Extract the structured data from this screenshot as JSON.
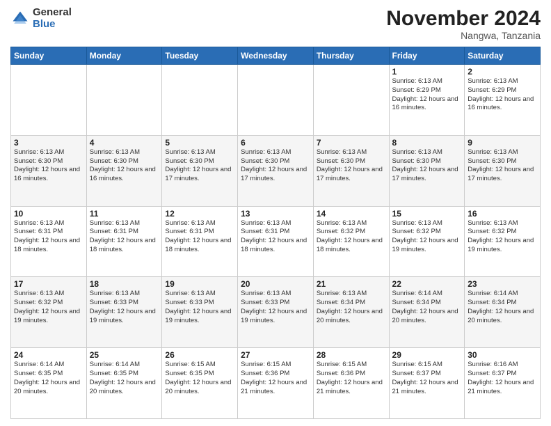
{
  "logo": {
    "general": "General",
    "blue": "Blue"
  },
  "header": {
    "month": "November 2024",
    "location": "Nangwa, Tanzania"
  },
  "days_of_week": [
    "Sunday",
    "Monday",
    "Tuesday",
    "Wednesday",
    "Thursday",
    "Friday",
    "Saturday"
  ],
  "weeks": [
    [
      {
        "day": "",
        "info": ""
      },
      {
        "day": "",
        "info": ""
      },
      {
        "day": "",
        "info": ""
      },
      {
        "day": "",
        "info": ""
      },
      {
        "day": "",
        "info": ""
      },
      {
        "day": "1",
        "info": "Sunrise: 6:13 AM\nSunset: 6:29 PM\nDaylight: 12 hours and 16 minutes."
      },
      {
        "day": "2",
        "info": "Sunrise: 6:13 AM\nSunset: 6:29 PM\nDaylight: 12 hours and 16 minutes."
      }
    ],
    [
      {
        "day": "3",
        "info": "Sunrise: 6:13 AM\nSunset: 6:30 PM\nDaylight: 12 hours and 16 minutes."
      },
      {
        "day": "4",
        "info": "Sunrise: 6:13 AM\nSunset: 6:30 PM\nDaylight: 12 hours and 16 minutes."
      },
      {
        "day": "5",
        "info": "Sunrise: 6:13 AM\nSunset: 6:30 PM\nDaylight: 12 hours and 17 minutes."
      },
      {
        "day": "6",
        "info": "Sunrise: 6:13 AM\nSunset: 6:30 PM\nDaylight: 12 hours and 17 minutes."
      },
      {
        "day": "7",
        "info": "Sunrise: 6:13 AM\nSunset: 6:30 PM\nDaylight: 12 hours and 17 minutes."
      },
      {
        "day": "8",
        "info": "Sunrise: 6:13 AM\nSunset: 6:30 PM\nDaylight: 12 hours and 17 minutes."
      },
      {
        "day": "9",
        "info": "Sunrise: 6:13 AM\nSunset: 6:30 PM\nDaylight: 12 hours and 17 minutes."
      }
    ],
    [
      {
        "day": "10",
        "info": "Sunrise: 6:13 AM\nSunset: 6:31 PM\nDaylight: 12 hours and 18 minutes."
      },
      {
        "day": "11",
        "info": "Sunrise: 6:13 AM\nSunset: 6:31 PM\nDaylight: 12 hours and 18 minutes."
      },
      {
        "day": "12",
        "info": "Sunrise: 6:13 AM\nSunset: 6:31 PM\nDaylight: 12 hours and 18 minutes."
      },
      {
        "day": "13",
        "info": "Sunrise: 6:13 AM\nSunset: 6:31 PM\nDaylight: 12 hours and 18 minutes."
      },
      {
        "day": "14",
        "info": "Sunrise: 6:13 AM\nSunset: 6:32 PM\nDaylight: 12 hours and 18 minutes."
      },
      {
        "day": "15",
        "info": "Sunrise: 6:13 AM\nSunset: 6:32 PM\nDaylight: 12 hours and 19 minutes."
      },
      {
        "day": "16",
        "info": "Sunrise: 6:13 AM\nSunset: 6:32 PM\nDaylight: 12 hours and 19 minutes."
      }
    ],
    [
      {
        "day": "17",
        "info": "Sunrise: 6:13 AM\nSunset: 6:32 PM\nDaylight: 12 hours and 19 minutes."
      },
      {
        "day": "18",
        "info": "Sunrise: 6:13 AM\nSunset: 6:33 PM\nDaylight: 12 hours and 19 minutes."
      },
      {
        "day": "19",
        "info": "Sunrise: 6:13 AM\nSunset: 6:33 PM\nDaylight: 12 hours and 19 minutes."
      },
      {
        "day": "20",
        "info": "Sunrise: 6:13 AM\nSunset: 6:33 PM\nDaylight: 12 hours and 19 minutes."
      },
      {
        "day": "21",
        "info": "Sunrise: 6:13 AM\nSunset: 6:34 PM\nDaylight: 12 hours and 20 minutes."
      },
      {
        "day": "22",
        "info": "Sunrise: 6:14 AM\nSunset: 6:34 PM\nDaylight: 12 hours and 20 minutes."
      },
      {
        "day": "23",
        "info": "Sunrise: 6:14 AM\nSunset: 6:34 PM\nDaylight: 12 hours and 20 minutes."
      }
    ],
    [
      {
        "day": "24",
        "info": "Sunrise: 6:14 AM\nSunset: 6:35 PM\nDaylight: 12 hours and 20 minutes."
      },
      {
        "day": "25",
        "info": "Sunrise: 6:14 AM\nSunset: 6:35 PM\nDaylight: 12 hours and 20 minutes."
      },
      {
        "day": "26",
        "info": "Sunrise: 6:15 AM\nSunset: 6:35 PM\nDaylight: 12 hours and 20 minutes."
      },
      {
        "day": "27",
        "info": "Sunrise: 6:15 AM\nSunset: 6:36 PM\nDaylight: 12 hours and 21 minutes."
      },
      {
        "day": "28",
        "info": "Sunrise: 6:15 AM\nSunset: 6:36 PM\nDaylight: 12 hours and 21 minutes."
      },
      {
        "day": "29",
        "info": "Sunrise: 6:15 AM\nSunset: 6:37 PM\nDaylight: 12 hours and 21 minutes."
      },
      {
        "day": "30",
        "info": "Sunrise: 6:16 AM\nSunset: 6:37 PM\nDaylight: 12 hours and 21 minutes."
      }
    ]
  ]
}
